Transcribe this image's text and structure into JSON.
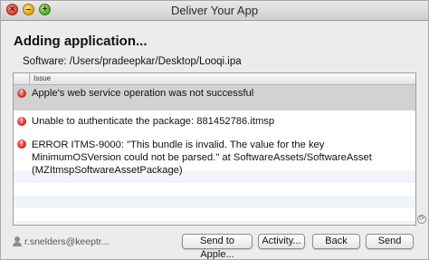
{
  "window": {
    "title": "Deliver Your App",
    "controls": {
      "close": "×",
      "minimize": "–",
      "zoom": "+"
    }
  },
  "heading": "Adding application...",
  "software": {
    "label": "Software:",
    "path": "/Users/pradeepkar/Desktop/Looqi.ipa"
  },
  "issues_table": {
    "column_header": "Issue",
    "rows": [
      {
        "icon": "error-icon",
        "message": "Apple's web service operation was not successful"
      },
      {
        "icon": "error-icon",
        "message": "Unable to authenticate the package: 881452786.itmsp"
      },
      {
        "icon": "error-icon",
        "message": "ERROR ITMS-9000: \"This bundle is invalid. The value for the key MinimumOSVersion could not be parsed.\" at SoftwareAssets/SoftwareAsset (MZItmspSoftwareAssetPackage)"
      }
    ]
  },
  "footer": {
    "user": "r.snelders@keeptr...",
    "buttons": {
      "send_to_apple": "Send to Apple...",
      "activity": "Activity...",
      "back": "Back",
      "send": "Send"
    }
  },
  "colors": {
    "selected_row": "#d2d2d2",
    "error_red": "#d4302a",
    "window_bg": "#ececec"
  }
}
